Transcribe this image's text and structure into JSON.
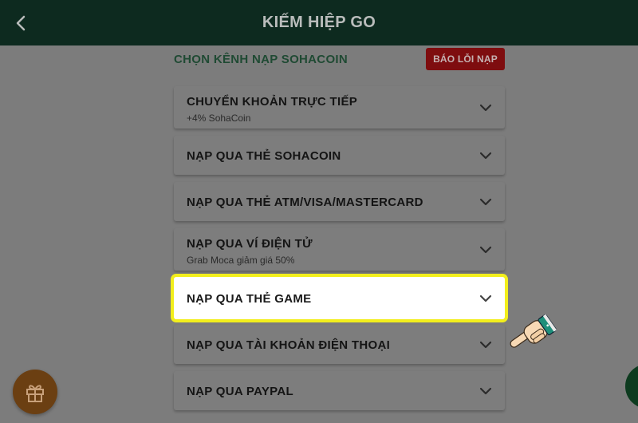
{
  "header": {
    "title": "KIẾM HIỆP GO",
    "back_icon": "chevron-left-icon"
  },
  "section": {
    "title": "CHỌN KÊNH NẠP SOHACOIN",
    "report_button": "BÁO LỖI NẠP"
  },
  "channels": [
    {
      "label": "CHUYỂN KHOẢN TRỰC TIẾP",
      "sub": "+4% SohaCoin"
    },
    {
      "label": "NẠP QUA THẺ SOHACOIN",
      "sub": ""
    },
    {
      "label": "NẠP QUA THẺ ATM/VISA/MASTERCARD",
      "sub": ""
    },
    {
      "label": "NẠP QUA VÍ ĐIỆN TỬ",
      "sub": "Grab Moca giảm giá 50%"
    },
    {
      "label": "NẠP QUA THẺ GAME",
      "sub": ""
    },
    {
      "label": "NẠP QUA TÀI KHOẢN ĐIỆN THOẠI",
      "sub": ""
    },
    {
      "label": "NẠP QUA PAYPAL",
      "sub": ""
    }
  ],
  "colors": {
    "header_bg": "#0d2a1f",
    "page_bg": "#7c7c7c",
    "accent_green": "#1f4a33",
    "report_red": "#7e0d0f",
    "highlight_border": "#f2ee1c",
    "gift_orange": "#6b3f12"
  },
  "icons": {
    "gift": "gift-icon",
    "pointer": "pointing-hand-icon",
    "expand": "chevron-down-icon"
  }
}
